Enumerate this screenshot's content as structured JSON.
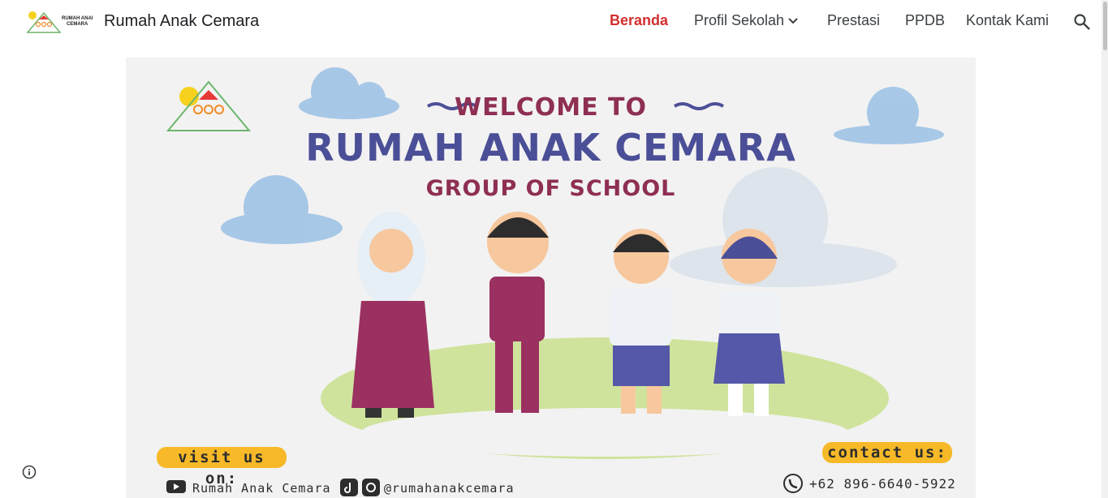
{
  "header": {
    "site_title": "Rumah Anak Cemara",
    "logo_text": "RUMAH ANAK CEMARA",
    "nav": [
      {
        "label": "Beranda",
        "active": true
      },
      {
        "label": "Profil Sekolah",
        "has_dropdown": true
      },
      {
        "label": "Prestasi"
      },
      {
        "label": "PPDB"
      },
      {
        "label": "Kontak Kami"
      }
    ],
    "search_icon": "search-icon",
    "active_color": "#d32f2f"
  },
  "banner": {
    "logo_caption": "RUMAH ANAK CEMARA",
    "welcome": "WELCOME TO",
    "name": "RUMAH ANAK CEMARA",
    "group": "GROUP OF SCHOOL",
    "visit_label": "visit us on:",
    "youtube_text": "Rumah Anak Cemara",
    "social_text": "@rumahanakcemara",
    "contact_label": "contact us:",
    "phone": "+62 896-6640-5922",
    "colors": {
      "primary": "#4b4f97",
      "secondary": "#8e2f53",
      "accent": "#f7b928",
      "background": "#f2f2f2"
    }
  },
  "footer": {
    "info_icon": "info-icon"
  }
}
